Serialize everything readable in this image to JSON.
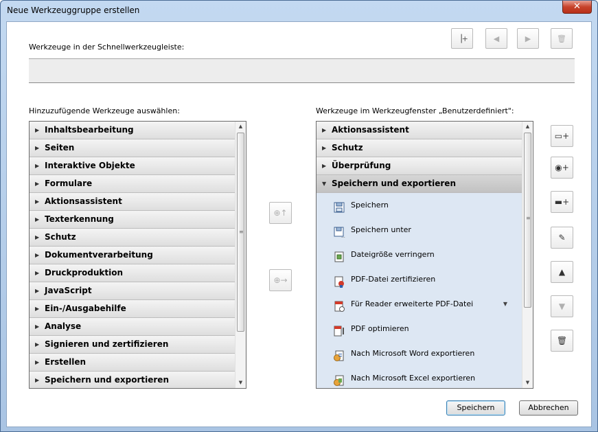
{
  "window": {
    "title": "Neue Werkzeuggruppe erstellen",
    "close_glyph": "✕"
  },
  "quick_toolbar": {
    "label": "Werkzeuge in der Schnellwerkzeugleiste:",
    "buttons": [
      {
        "icon": "add-divider-icon",
        "glyph": "▕+",
        "enabled": true
      },
      {
        "icon": "move-left-icon",
        "glyph": "◀",
        "enabled": false
      },
      {
        "icon": "move-right-icon",
        "glyph": "▶",
        "enabled": false
      },
      {
        "icon": "trash-icon",
        "glyph": "🗑",
        "enabled": false
      }
    ]
  },
  "left_panel": {
    "label": "Hinzuzufügende Werkzeuge auswählen:",
    "items": [
      "Inhaltsbearbeitung",
      "Seiten",
      "Interaktive Objekte",
      "Formulare",
      "Aktionsassistent",
      "Texterkennung",
      "Schutz",
      "Dokumentverarbeitung",
      "Druckproduktion",
      "JavaScript",
      "Ein-/Ausgabehilfe",
      "Analyse",
      "Signieren und zertifizieren",
      "Erstellen",
      "Speichern und exportieren"
    ]
  },
  "middle_buttons": [
    {
      "icon": "add-to-toolbar-icon",
      "glyph": "⊕↑"
    },
    {
      "icon": "add-to-panel-icon",
      "glyph": "⊕→"
    }
  ],
  "right_panel": {
    "label": "Werkzeuge im Werkzeugfenster „Benutzerdefiniert\":",
    "collapsed": [
      "Aktionsassistent",
      "Schutz",
      "Überprüfung"
    ],
    "expanded_group": "Speichern und exportieren",
    "subitems": [
      {
        "label": "Speichern",
        "icon": "save-icon"
      },
      {
        "label": "Speichern unter",
        "icon": "save-as-icon"
      },
      {
        "label": "Dateigröße verringern",
        "icon": "reduce-size-icon"
      },
      {
        "label": "PDF-Datei zertifizieren",
        "icon": "certify-pdf-icon"
      },
      {
        "label": "Für Reader erweiterte PDF-Datei",
        "icon": "reader-extend-icon",
        "has_dropdown": true
      },
      {
        "label": "PDF optimieren",
        "icon": "optimize-pdf-icon"
      },
      {
        "label": "Nach Microsoft Word exportieren",
        "icon": "export-word-icon"
      },
      {
        "label": "Nach Microsoft Excel exportieren",
        "icon": "export-excel-icon"
      }
    ]
  },
  "side_buttons": [
    {
      "icon": "new-panel-icon",
      "glyph": "▭+",
      "enabled": true
    },
    {
      "icon": "add-group-icon",
      "glyph": "◉+",
      "enabled": true
    },
    {
      "icon": "add-separator-icon",
      "glyph": "▬+",
      "enabled": true
    },
    {
      "icon": "rename-pencil-icon",
      "glyph": "✎",
      "enabled": true
    },
    {
      "icon": "move-up-icon",
      "glyph": "▲",
      "enabled": true
    },
    {
      "icon": "move-down-icon",
      "glyph": "▼",
      "enabled": false
    },
    {
      "icon": "delete-icon",
      "glyph": "🗑",
      "enabled": true
    }
  ],
  "footer": {
    "save": "Speichern",
    "cancel": "Abbrechen"
  },
  "colors": {
    "subitem_bg": "#dde7f3",
    "title_bar": "#b9d1ea"
  }
}
